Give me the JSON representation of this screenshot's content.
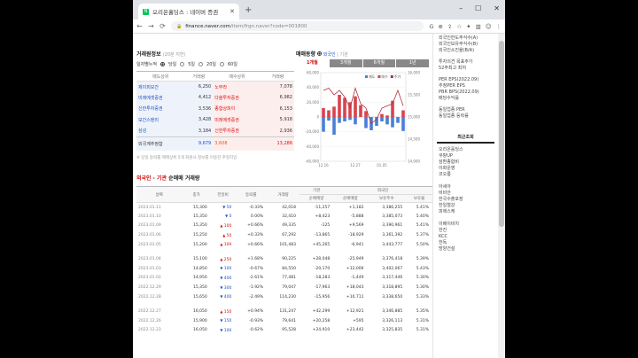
{
  "browser": {
    "tab_title": "오리온홀딩스 : 네이버 증권",
    "favicon": "N",
    "url_domain": "finance.naver.com",
    "url_path": "/item/frgn.naver?code=001800",
    "new_tab": "+",
    "controls": {
      "min": "–",
      "max": "☐",
      "close": "✕"
    }
  },
  "brokers": {
    "title": "거래원정보",
    "subtitle": "(20분 지연)",
    "period_label": "일자별누적",
    "periods": [
      "당일",
      "5일",
      "20일",
      "60일"
    ],
    "headers": [
      "매도상위",
      "거래량",
      "매수상위",
      "거래량"
    ],
    "rows": [
      {
        "sell": "제이피모간",
        "sell_vol": "6,250",
        "buy": "노무라",
        "buy_vol": "7,078"
      },
      {
        "sell": "미래에셋증권",
        "sell_vol": "4,412",
        "buy": "다올투자증권",
        "buy_vol": "6,982"
      },
      {
        "sell": "신한투자증권",
        "sell_vol": "3,536",
        "buy": "종합상피이",
        "buy_vol": "6,153"
      },
      {
        "sell": "모간스탠리",
        "sell_vol": "3,428",
        "buy": "미래에셋증권",
        "buy_vol": "5,918"
      },
      {
        "sell": "삼성",
        "sell_vol": "3,184",
        "buy": "신한투자증권",
        "buy_vol": "2,936"
      }
    ],
    "foreign_label": "외국계추정합",
    "foreign_sell": "9,679",
    "foreign_diff": "3,608",
    "foreign_buy": "13,286",
    "note": "※ 당일 등락률 메매상위 5개 회원사 정보를 이용한 추정치임"
  },
  "chart": {
    "title": "매매동향",
    "filter_foreign": "외국인",
    "filter_inst": "기관",
    "tabs": [
      "1개월",
      "3개월",
      "6개월",
      "1년"
    ],
    "legend_sell": "매도",
    "legend_buy": "매수",
    "legend_price": "주가",
    "left_ticks": [
      "60,000",
      "40,000",
      "20,000",
      "0",
      "-20,000",
      "-40,000",
      "-60,000"
    ],
    "right_ticks": [
      "16,000",
      "15,500",
      "15,000",
      "14,500",
      "14,000"
    ],
    "x_ticks": [
      "12.16",
      "12.27",
      "01.05"
    ],
    "colors": {
      "buy": "#d9434e",
      "sell": "#4a7fd6",
      "price": "#b03040"
    }
  },
  "chart_data": {
    "type": "bar",
    "categories": [
      "12.16",
      "",
      "",
      "",
      "",
      "",
      "12.27",
      "",
      "",
      "",
      "",
      "01.05",
      "",
      "",
      "",
      ""
    ],
    "series": [
      {
        "name": "매수",
        "values": [
          12000,
          9000,
          14000,
          30000,
          26000,
          20000,
          28000,
          16000,
          8000,
          0,
          0,
          4000,
          2000,
          22000,
          0,
          9000
        ]
      },
      {
        "name": "매도",
        "values": [
          -20000,
          -5000,
          -24000,
          -8000,
          -6000,
          -4000,
          -10000,
          0,
          -15000,
          -18000,
          -12000,
          -6000,
          -10000,
          -14000,
          -8000,
          -19000
        ]
      },
      {
        "name": "주가",
        "values": [
          15600,
          15650,
          15500,
          15600,
          15450,
          15200,
          15650,
          15300,
          15200,
          14850,
          14950,
          15200,
          15250,
          15300,
          15600,
          15250
        ]
      }
    ],
    "ylim": [
      -60000,
      60000
    ],
    "ylim_right": [
      14000,
      16000
    ]
  },
  "trades": {
    "title_a": "외국인",
    "title_b": "기관",
    "title_c": "순매매 거래량",
    "headers": [
      "날짜",
      "종가",
      "전일비",
      "등락률",
      "거래량",
      "순매매량",
      "순매매량",
      "보유주수",
      "보유율"
    ],
    "group_inst": "기관",
    "group_foreign": "외국인",
    "rows": [
      {
        "date": "2023.01.11",
        "close": "15,300",
        "dir": "dn",
        "chg": "50",
        "rate": "-0.33%",
        "vol": "42,018",
        "inst": "-11,257",
        "frgn": "+1,182",
        "hold": "3,386,255",
        "ratio": "5.41%"
      },
      {
        "date": "2023.01.10",
        "close": "15,350",
        "dir": "dn",
        "chg": "0",
        "rate": "0.00%",
        "vol": "32,410",
        "inst": "+8,423",
        "frgn": "-5,888",
        "hold": "3,385,073",
        "ratio": "5.40%"
      },
      {
        "date": "2023.01.09",
        "close": "15,350",
        "dir": "up",
        "chg": "100",
        "rate": "+0.66%",
        "vol": "49,335",
        "inst": "-125",
        "frgn": "+9,569",
        "hold": "3,390,961",
        "ratio": "5.41%"
      },
      {
        "date": "2023.01.06",
        "close": "15,250",
        "dir": "up",
        "chg": "50",
        "rate": "+0.33%",
        "vol": "67,292",
        "inst": "-13,865",
        "frgn": "-18,929",
        "hold": "3,361,392",
        "ratio": "5.37%"
      },
      {
        "date": "2023.01.05",
        "close": "15,200",
        "dir": "up",
        "chg": "100",
        "rate": "+0.66%",
        "vol": "101,483",
        "inst": "+45,265",
        "frgn": "-6,941",
        "hold": "3,443,777",
        "ratio": "5.50%"
      },
      {
        "date": "2023.01.04",
        "close": "15,100",
        "dir": "up",
        "chg": "250",
        "rate": "+1.68%",
        "vol": "90,225",
        "inst": "+28,048",
        "frgn": "-25,949",
        "hold": "3,376,418",
        "ratio": "5.39%"
      },
      {
        "date": "2023.01.03",
        "close": "14,850",
        "dir": "dn",
        "chg": "100",
        "rate": "-0.67%",
        "vol": "84,550",
        "inst": "-20,170",
        "frgn": "+12,006",
        "hold": "3,402,067",
        "ratio": "5.43%"
      },
      {
        "date": "2023.01.02",
        "close": "14,950",
        "dir": "dn",
        "chg": "400",
        "rate": "-2.61%",
        "vol": "77,481",
        "inst": "-18,283",
        "frgn": "-1,449",
        "hold": "3,317,446",
        "ratio": "5.30%"
      },
      {
        "date": "2022.12.29",
        "close": "15,350",
        "dir": "dn",
        "chg": "300",
        "rate": "-1.92%",
        "vol": "79,047",
        "inst": "-17,963",
        "frgn": "+18,043",
        "hold": "3,318,895",
        "ratio": "5.30%"
      },
      {
        "date": "2022.12.28",
        "close": "15,650",
        "dir": "dn",
        "chg": "400",
        "rate": "-2.49%",
        "vol": "114,230",
        "inst": "-15,956",
        "frgn": "+10,711",
        "hold": "3,338,650",
        "ratio": "5.33%"
      },
      {
        "date": "2022.12.27",
        "close": "16,050",
        "dir": "up",
        "chg": "150",
        "rate": "+0.94%",
        "vol": "131,247",
        "inst": "+42,299",
        "frgn": "+12,921",
        "hold": "3,346,885",
        "ratio": "5.35%"
      },
      {
        "date": "2022.12.26",
        "close": "15,900",
        "dir": "dn",
        "chg": "150",
        "rate": "-0.93%",
        "vol": "79,641",
        "inst": "+20,258",
        "frgn": "+595",
        "hold": "3,326,113",
        "ratio": "5.31%"
      },
      {
        "date": "2022.12.23",
        "close": "16,050",
        "dir": "dn",
        "chg": "100",
        "rate": "-0.62%",
        "vol": "95,528",
        "inst": "+24,910",
        "frgn": "+23,442",
        "hold": "3,325,835",
        "ratio": "5.31%"
      }
    ]
  },
  "sidebar": {
    "top_items": [
      "외국인한도주식수(A)",
      "외국인보유주식수(B)",
      "외국인소진율(B/A)"
    ],
    "mid_items": [
      "투자의견  목표주가",
      "52주최고  최저"
    ],
    "per_items": [
      "PER  EPS(2022.09)",
      "추정PER  EPS",
      "PBR  BPS(2022.09)",
      "배당수익률"
    ],
    "sector_items": [
      "동일업종 PER",
      "동일업종 등락률"
    ],
    "recent_title": "최근조회",
    "recent_items": [
      "오리온홀딩스",
      "쿠팡UP",
      "삼환종합비",
      "이화운영",
      "코오롱",
      "",
      "아세아",
      "비비안",
      "한국수출포장",
      "한일철강",
      "피에스케",
      "",
      "이베이비치",
      "한진",
      "KCC",
      "한독",
      "방양건설"
    ]
  }
}
